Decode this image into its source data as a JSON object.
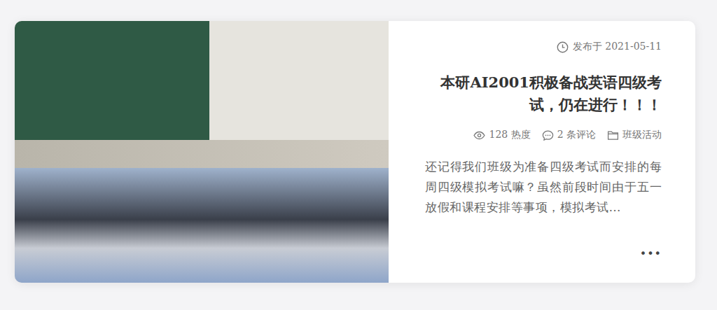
{
  "post": {
    "date_label": "发布于 2021-05-11",
    "title": "本研AI2001积极备战英语四级考试，仍在进行！！！",
    "meta": [
      {
        "kind": "views",
        "text": "128 热度"
      },
      {
        "kind": "comments",
        "text": "2 条评论"
      },
      {
        "kind": "category",
        "text": "班级活动"
      }
    ],
    "excerpt": "还记得我们班级为准备四级考试而安排的每周四级模拟考试嘛？虽然前段时间由于五一放假和课程安排等事项，模拟考试…",
    "more": "•••"
  }
}
